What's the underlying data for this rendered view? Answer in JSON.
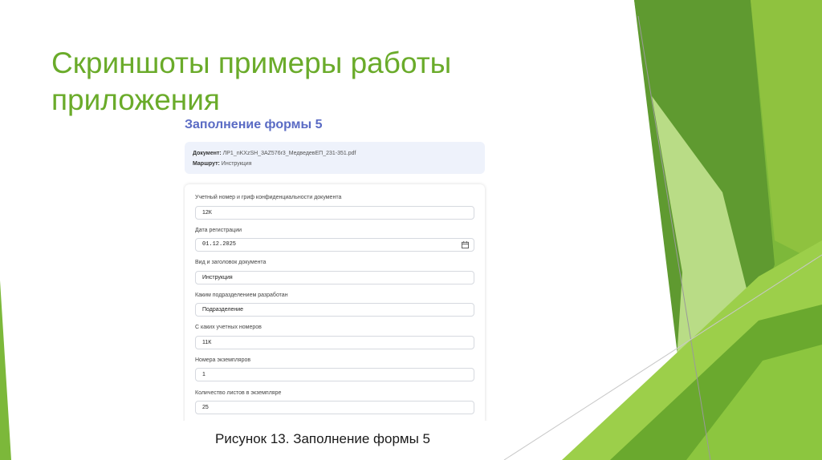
{
  "slide": {
    "title": "Скриншоты примеры работы приложения",
    "caption": "Рисунок 13. Заполнение формы 5"
  },
  "screenshot": {
    "form_title": "Заполнение формы 5",
    "info": {
      "document_label": "Документ:",
      "document_value": "ЛР1_nKXzSH_3AZ576r3_МедведевЕП_231-351.pdf",
      "route_label": "Маршрут:",
      "route_value": "Инструкция"
    },
    "fields": [
      {
        "label": "Учетный номер и гриф конфиденциальности документа",
        "value": "12К"
      },
      {
        "label": "Дата регистрации",
        "value": "01.12.2025"
      },
      {
        "label": "Вид и заголовок документа",
        "value": "Инструкция"
      },
      {
        "label": "Каким подразделением разработан",
        "value": "Подразделение"
      },
      {
        "label": "С каких учетных номеров",
        "value": "11К"
      },
      {
        "label": "Номера экземпляров",
        "value": "1"
      },
      {
        "label": "Количество листов в экземпляре",
        "value": "25"
      }
    ]
  },
  "colors": {
    "title_green": "#6aab2a",
    "form_title_blue": "#5a6bc4",
    "info_card_bg": "#eef2fb"
  },
  "icons": {
    "date_field": "calendar-icon"
  }
}
